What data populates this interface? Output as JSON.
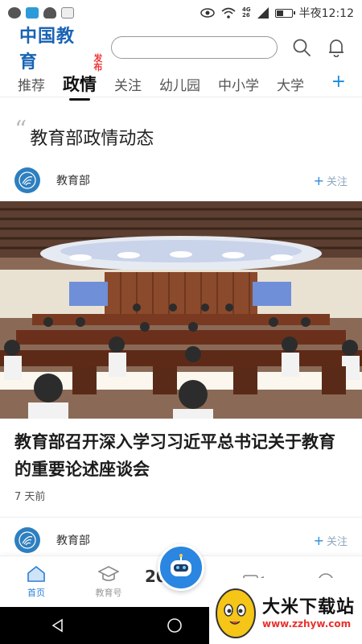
{
  "status_bar": {
    "time": "半夜12:12",
    "network": "4G\n26"
  },
  "header": {
    "logo_main": "中国教育",
    "logo_sub": "发布",
    "search_placeholder": ""
  },
  "tabs": [
    {
      "label": "推荐"
    },
    {
      "label": "政情"
    },
    {
      "label": "关注"
    },
    {
      "label": "幼儿园"
    },
    {
      "label": "中小学"
    },
    {
      "label": "大学"
    }
  ],
  "tab_add": "+",
  "section": {
    "title": "教育部政情动态"
  },
  "feed": [
    {
      "author": "教育部",
      "follow": "关注",
      "title": "教育部召开深入学习习近平总书记关于教育的重要论述座谈会",
      "time": "7 天前"
    },
    {
      "author": "教育部",
      "follow": "关注",
      "peek_title": "20   国"
    }
  ],
  "bottom_nav": [
    {
      "label": "首页",
      "icon": "home-icon"
    },
    {
      "label": "教育号",
      "icon": "graduation-cap-icon"
    },
    {
      "label": "",
      "icon": "robot-assistant-icon"
    },
    {
      "label": "",
      "icon": "video-icon"
    },
    {
      "label": "",
      "icon": "chat-icon"
    }
  ],
  "watermark": {
    "name": "大米下载站",
    "url": "www.zzhyw.com"
  },
  "colors": {
    "accent": "#2a86e0",
    "logo_blue": "#1a63b5",
    "logo_red": "#ee3333"
  }
}
